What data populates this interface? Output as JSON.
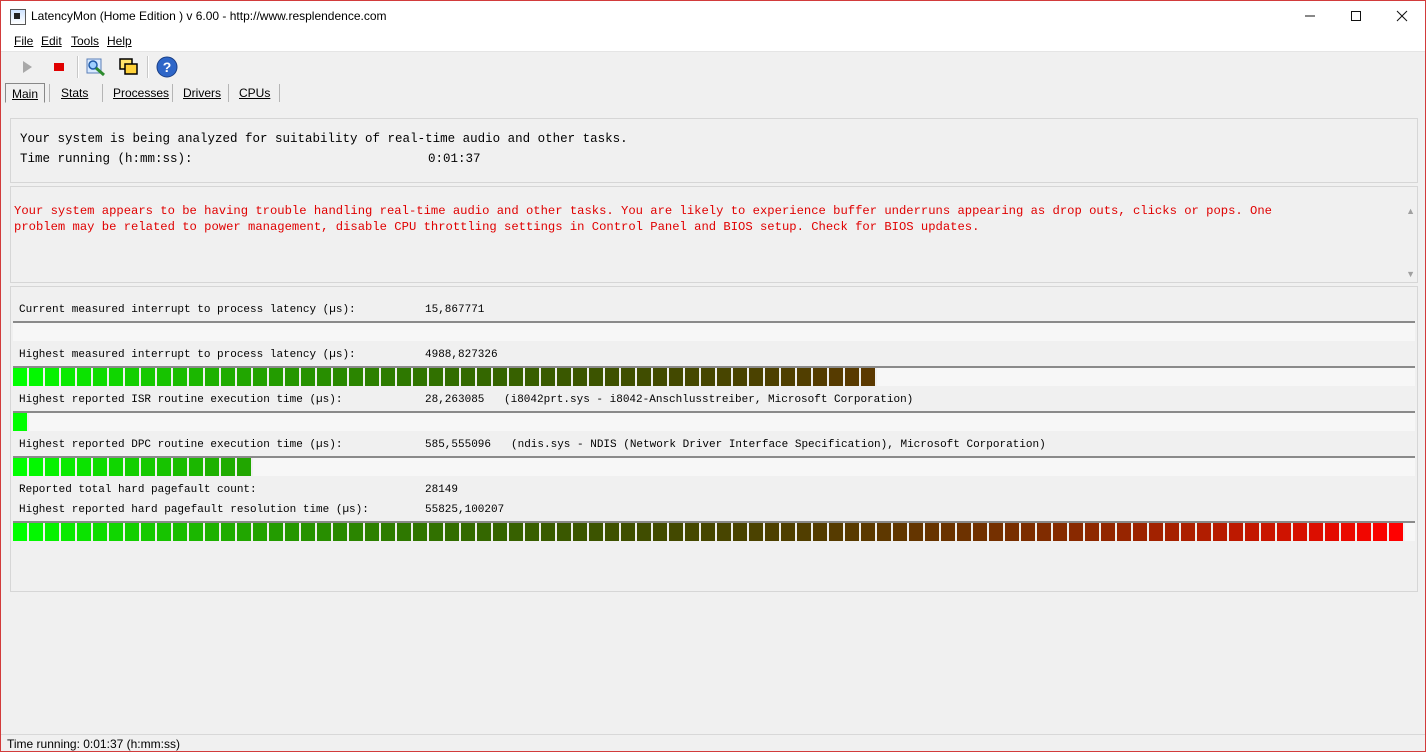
{
  "window": {
    "title": "LatencyMon  (Home Edition )  v 6.00 - http://www.resplendence.com",
    "minimize_icon": "minimize-icon",
    "maximize_icon": "maximize-icon",
    "close_icon": "close-icon"
  },
  "menu": {
    "items": [
      {
        "label": "File"
      },
      {
        "label": "Edit"
      },
      {
        "label": "Tools"
      },
      {
        "label": "Help"
      }
    ]
  },
  "toolbar": {
    "icons": [
      "play-icon",
      "stop-icon",
      "driver-search-icon",
      "windows-icon",
      "help-icon"
    ]
  },
  "tabs": [
    {
      "label": "Main",
      "selected": true
    },
    {
      "label": "Stats",
      "selected": false
    },
    {
      "label": "Processes",
      "selected": false
    },
    {
      "label": "Drivers",
      "selected": false
    },
    {
      "label": "CPUs",
      "selected": false
    }
  ],
  "analysis": {
    "line1": "Your system is being analyzed for suitability of real-time audio and other tasks.",
    "time_label": "Time running (h:mm:ss):",
    "time_value": "0:01:37"
  },
  "warning": {
    "line1": "Your system appears to be having trouble handling real-time audio and other tasks. You are likely to experience buffer underruns appearing as drop outs, clicks or pops. One",
    "line2": "problem may be related to power management, disable CPU throttling settings in Control Panel and BIOS setup. Check for BIOS updates.",
    "color": "#e00000"
  },
  "metrics": {
    "current_latency": {
      "label": "Current measured interrupt to process latency (µs):",
      "value": "15,867771",
      "level": 0.0
    },
    "highest_latency": {
      "label": "Highest measured interrupt to process latency (µs):",
      "value": "4988,827326",
      "level": 0.626
    },
    "isr": {
      "label": "Highest reported ISR routine execution time (µs):",
      "value": "28,263085",
      "detail": "(i8042prt.sys - i8042-Anschlusstreiber, Microsoft Corporation)",
      "level": 0.011
    },
    "dpc": {
      "label": "Highest reported DPC routine execution time (µs):",
      "value": "585,555096",
      "detail": "(ndis.sys - NDIS (Network Driver Interface Specification), Microsoft Corporation)",
      "level": 0.17
    },
    "pagefault_count": {
      "label": "Reported total hard pagefault count:",
      "value": "28149"
    },
    "pagefault_time": {
      "label": "Highest reported hard pagefault resolution time (µs):",
      "value": "55825,100207",
      "level": 1.0
    }
  },
  "statusbar": {
    "text": "Time running: 0:01:37  (h:mm:ss)"
  },
  "colors": {
    "bar_start": "#00ff00",
    "bar_end": "#ff0000",
    "accent_border": "#d23b3b"
  }
}
